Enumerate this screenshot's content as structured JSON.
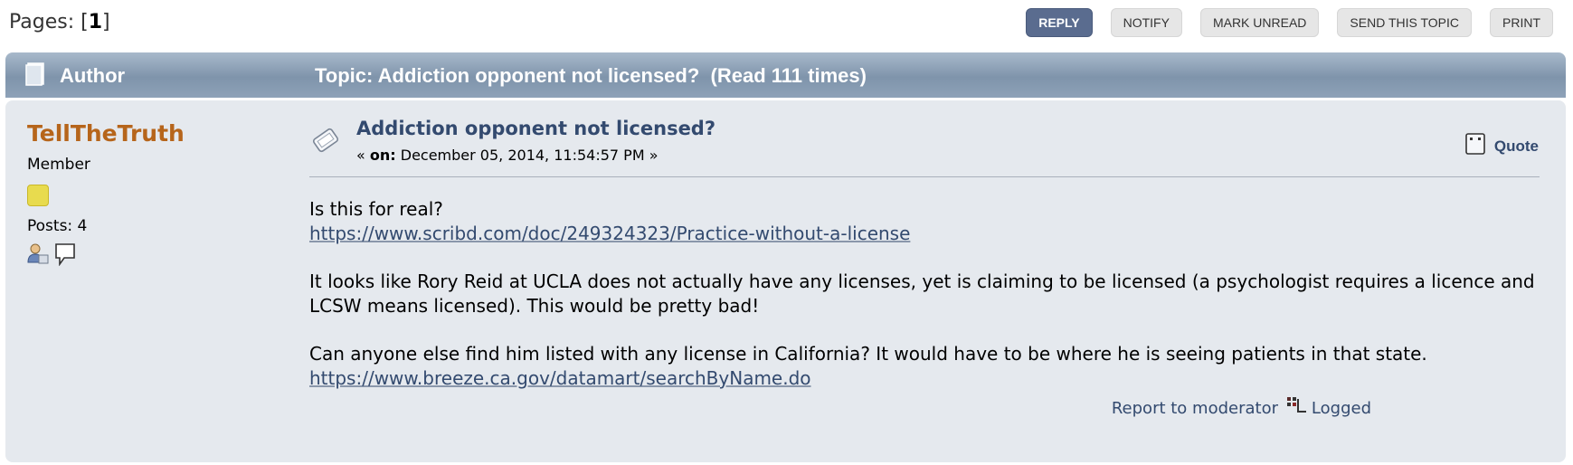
{
  "pages": {
    "label": "Pages:",
    "current": "1"
  },
  "buttons": [
    "REPLY",
    "NOTIFY",
    "MARK UNREAD",
    "SEND THIS TOPIC",
    "PRINT"
  ],
  "header": {
    "author_label": "Author",
    "topic_label": "Topic: Addiction opponent not licensed?  (Read 111 times)"
  },
  "post": {
    "username": "TellTheTruth",
    "group": "Member",
    "posts": "Posts: 4",
    "subject": "Addiction opponent not licensed?",
    "on_label": "on:",
    "date": "December 05, 2014, 11:54:57 PM",
    "quote_label": "Quote",
    "line1": "Is this for real?",
    "link1": "https://www.scribd.com/doc/249324323/Practice-without-a-license",
    "para2": "It looks like Rory Reid at UCLA does not actually have any licenses, yet is claiming to be licensed (a psychologist requires a licence and LCSW means licensed). This would be pretty bad!",
    "para3": "Can anyone else find him listed with any license in California? It would have to be where he is seeing patients in that state.",
    "link2": "https://www.breeze.ca.gov/datamart/searchByName.do",
    "report_label": "Report to moderator",
    "logged_label": "Logged"
  },
  "colors": {
    "username": "#b6651b",
    "link": "#334a6f",
    "header_bar": "#8ea2b8",
    "post_bg": "#e5e9ee"
  },
  "icons": [
    "document-icon",
    "subject-icon",
    "quote-icon",
    "profile-icon",
    "message-icon",
    "logged-ip-icon"
  ]
}
